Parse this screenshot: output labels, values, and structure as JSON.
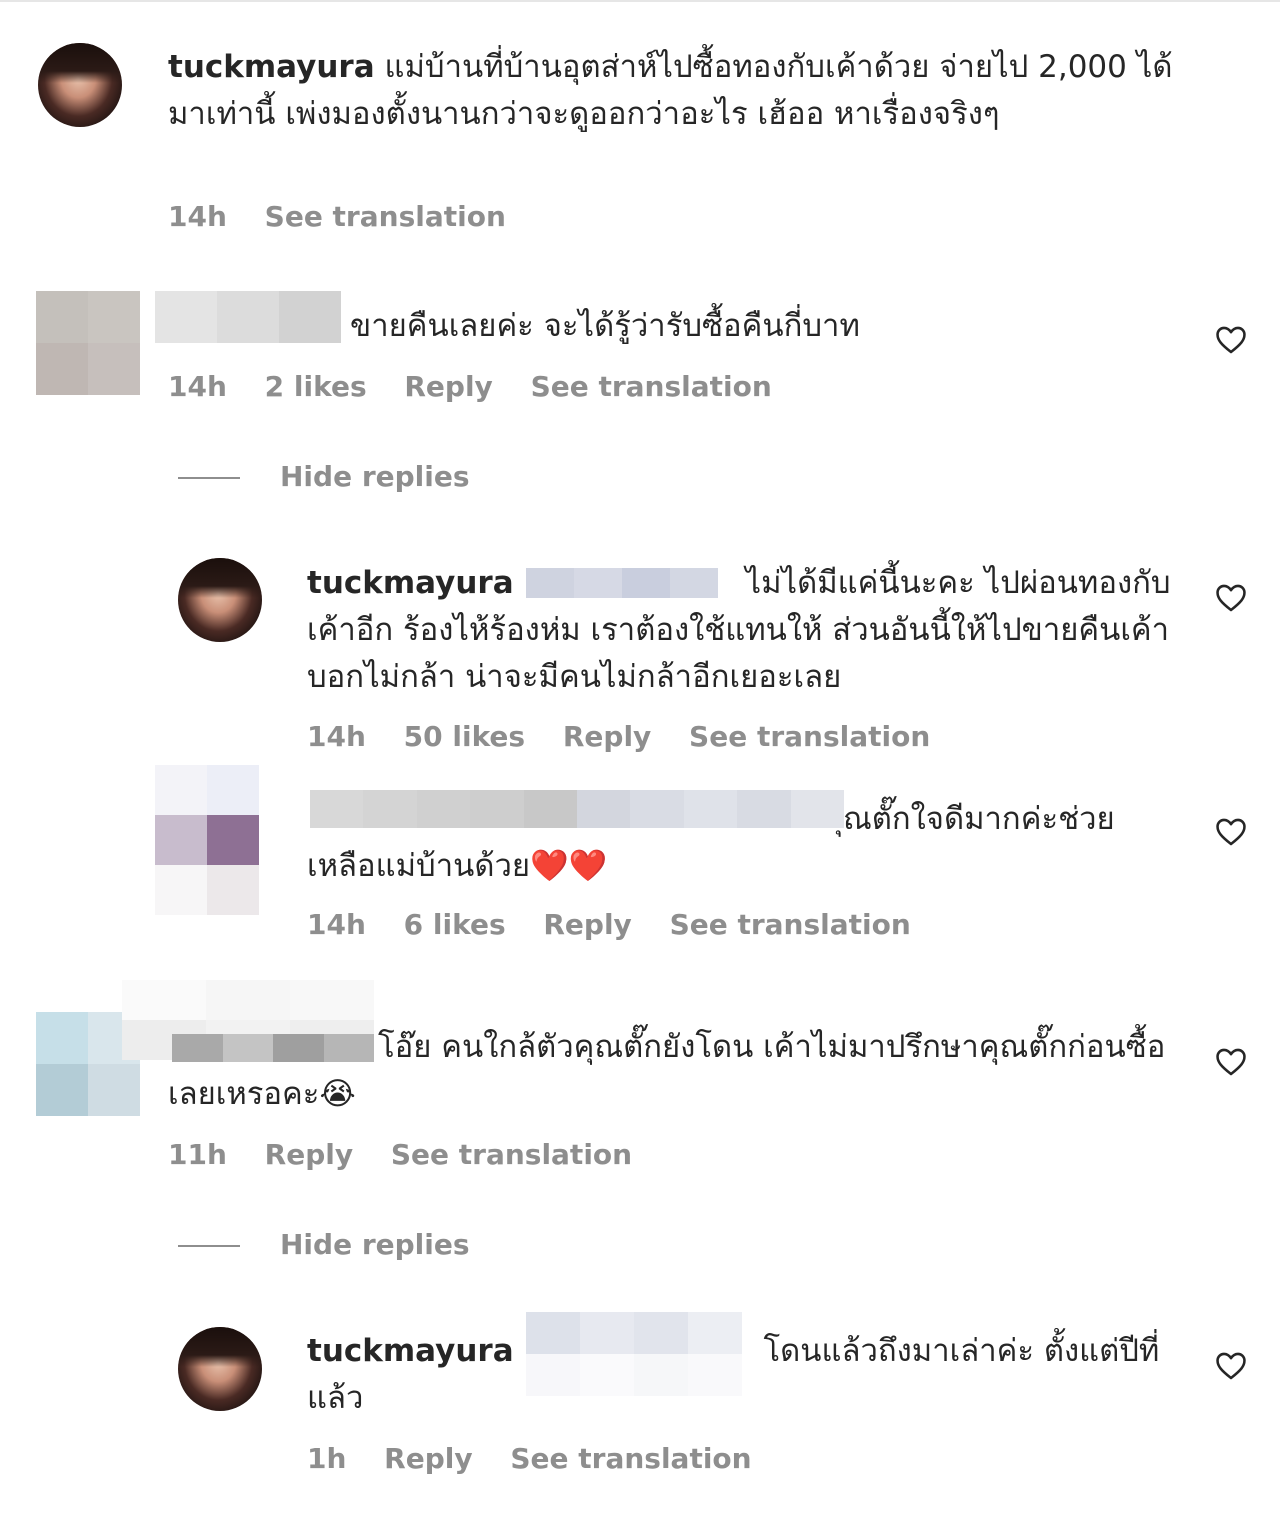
{
  "comments": [
    {
      "username": "tuckmayura",
      "text": "แม่บ้านที่บ้านอุตส่าห์ไปซื้อทองกับเค้าด้วย จ่ายไป 2,000 ได้มาเท่านี้ เพ่งมองตั้งนานกว่าจะดูออกว่าอะไร เฮ้ออ หาเรื่องจริงๆ",
      "time": "14h",
      "see_translation": "See translation"
    },
    {
      "username": "",
      "text": "ขายคืนเลยค่ะ จะได้รู้ว่ารับซื้อคืนกี่บาท",
      "time": "14h",
      "likes": "2 likes",
      "reply": "Reply",
      "see_translation": "See translation",
      "hide_replies": "Hide replies",
      "replies": [
        {
          "username": "tuckmayura",
          "text": "ไม่ได้มีแค่นี้นะคะ ไปผ่อนทองกับเค้าอีก ร้องไห้ร้องห่ม เราต้องใช้แทนให้ ส่วนอันนี้ให้ไปขายคืนเค้าบอกไม่กล้า น่าจะมีคนไม่กล้าอีกเยอะเลย",
          "time": "14h",
          "likes": "50 likes",
          "reply": "Reply",
          "see_translation": "See translation"
        },
        {
          "username": "",
          "text": "ุณตั๊กใจดีมากค่ะช่วยเหลือแม่บ้านด้วย❤️❤️",
          "time": "14h",
          "likes": "6 likes",
          "reply": "Reply",
          "see_translation": "See translation"
        }
      ]
    },
    {
      "username": "",
      "text": "โอ๊ย คนใกล้ตัวคุณตั๊กยังโดน เค้าไม่มาปรึกษาคุณตั๊กก่อนซื้อเลยเหรอคะ😭",
      "time": "11h",
      "reply": "Reply",
      "see_translation": "See translation",
      "hide_replies": "Hide replies",
      "replies": [
        {
          "username": "tuckmayura",
          "text": "โดนแล้วถึงมาเล่าค่ะ ตั้งแต่ปีที่แล้ว",
          "time": "1h",
          "reply": "Reply",
          "see_translation": "See translation"
        }
      ]
    }
  ],
  "icons": {
    "like": "heart-outline-icon"
  },
  "colors": {
    "text": "#262626",
    "meta": "#8e8e8e",
    "heart_emoji": "#e0201f"
  }
}
